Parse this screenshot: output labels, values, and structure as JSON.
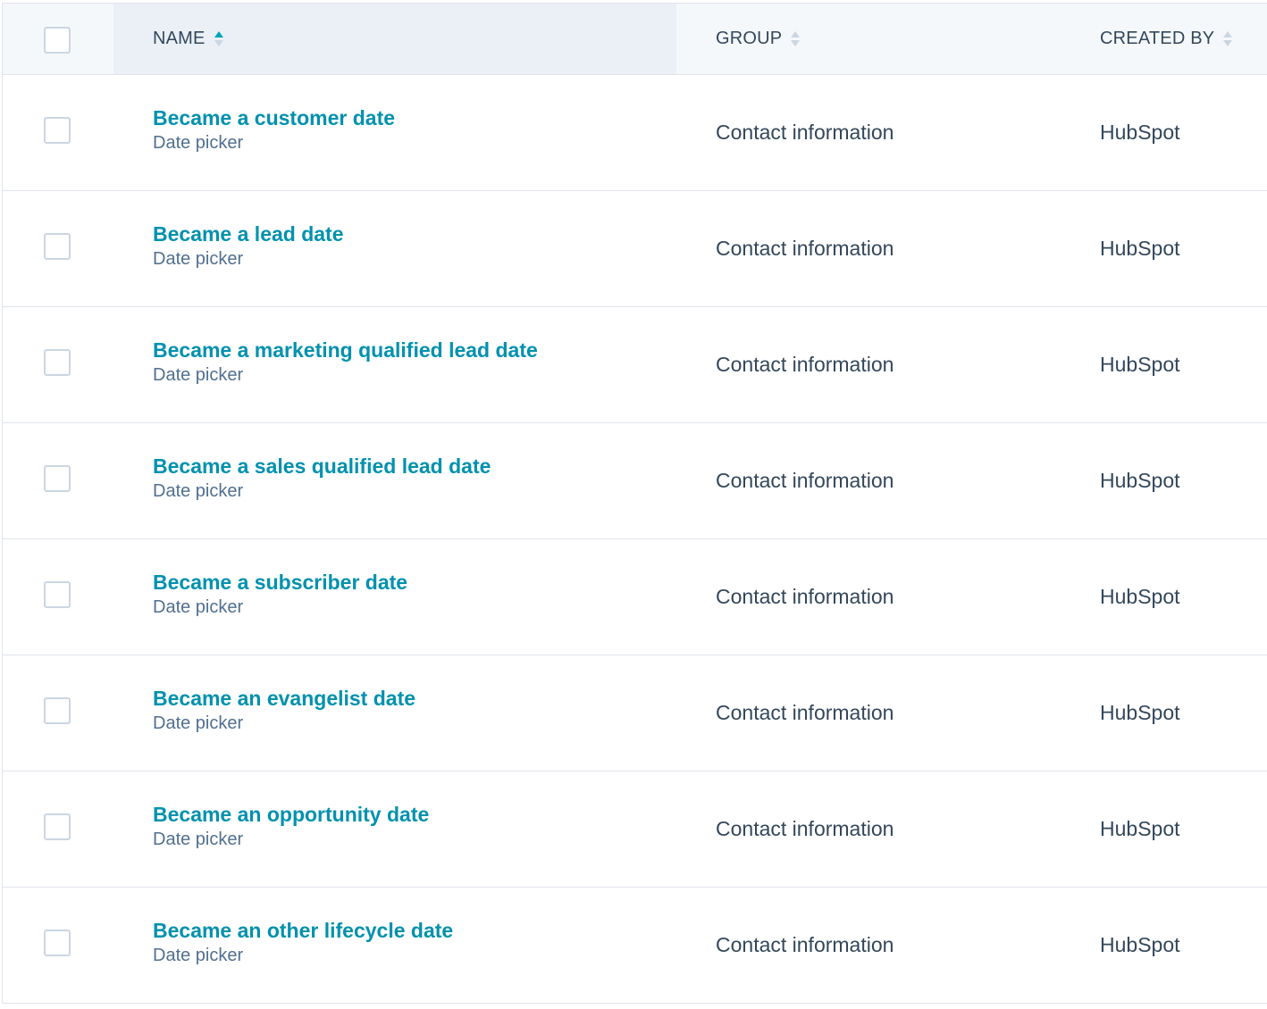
{
  "table": {
    "headers": {
      "name": "NAME",
      "group": "GROUP",
      "created_by": "CREATED BY"
    },
    "sort": {
      "column": "name",
      "direction": "ascending"
    },
    "rows": [
      {
        "name": "Became a customer date",
        "type": "Date picker",
        "group": "Contact information",
        "created_by": "HubSpot"
      },
      {
        "name": "Became a lead date",
        "type": "Date picker",
        "group": "Contact information",
        "created_by": "HubSpot"
      },
      {
        "name": "Became a marketing qualified lead date",
        "type": "Date picker",
        "group": "Contact information",
        "created_by": "HubSpot"
      },
      {
        "name": "Became a sales qualified lead date",
        "type": "Date picker",
        "group": "Contact information",
        "created_by": "HubSpot"
      },
      {
        "name": "Became a subscriber date",
        "type": "Date picker",
        "group": "Contact information",
        "created_by": "HubSpot"
      },
      {
        "name": "Became an evangelist date",
        "type": "Date picker",
        "group": "Contact information",
        "created_by": "HubSpot"
      },
      {
        "name": "Became an opportunity date",
        "type": "Date picker",
        "group": "Contact information",
        "created_by": "HubSpot"
      },
      {
        "name": "Became an other lifecycle date",
        "type": "Date picker",
        "group": "Contact information",
        "created_by": "HubSpot"
      }
    ]
  },
  "colors": {
    "link": "#0091ae",
    "sort_active": "#00a4bd",
    "text": "#33475b",
    "subtext": "#516f90",
    "border": "#dfe3eb",
    "header_bg": "#f5f8fa",
    "sorted_column_bg": "#eaf0f6"
  },
  "icons": {
    "sort_active": "sort-ascending-icon",
    "sort_inactive": "sort-icon"
  }
}
